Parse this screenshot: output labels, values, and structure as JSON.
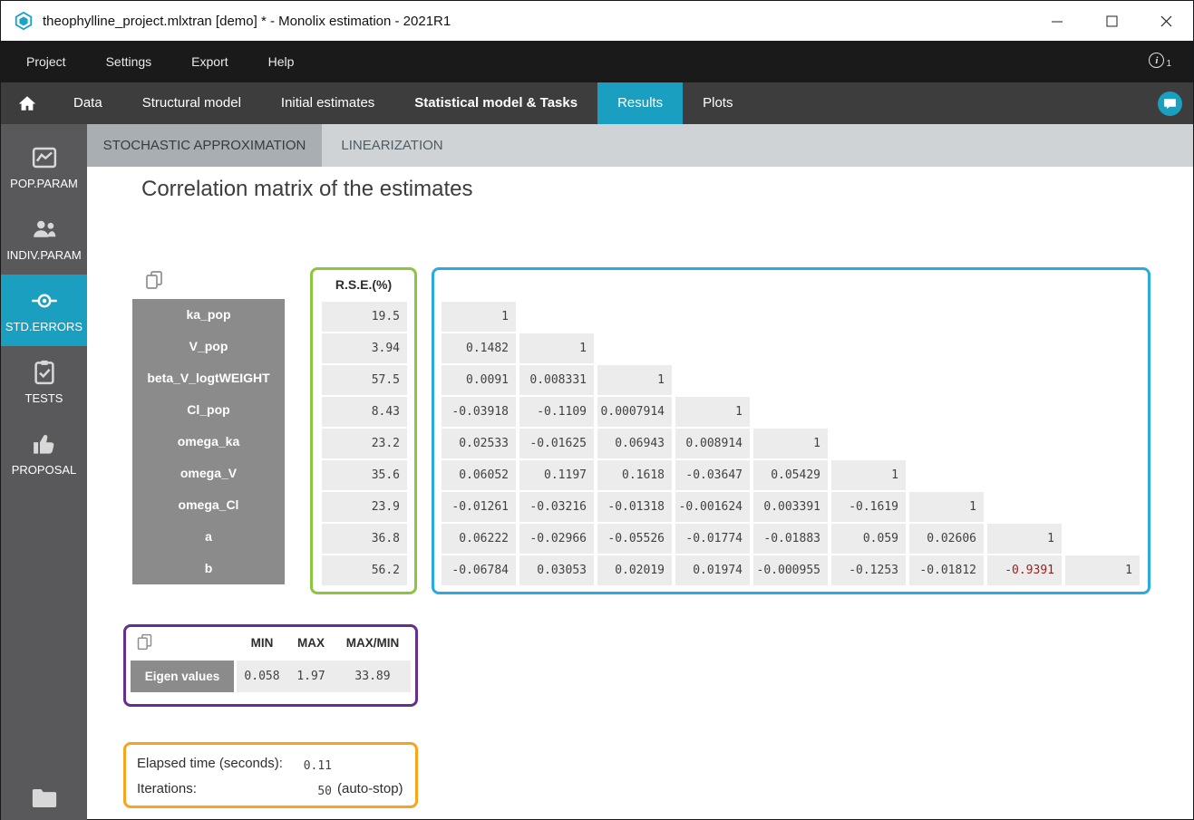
{
  "window": {
    "title": "theophylline_project.mlxtran [demo] * - Monolix estimation - 2021R1"
  },
  "menubar": {
    "items": [
      "Project",
      "Settings",
      "Export",
      "Help"
    ],
    "info_badge": "1"
  },
  "nav": {
    "tabs": [
      {
        "label": "Data",
        "active": false,
        "bold": false
      },
      {
        "label": "Structural model",
        "active": false,
        "bold": false
      },
      {
        "label": "Initial estimates",
        "active": false,
        "bold": false
      },
      {
        "label": "Statistical model & Tasks",
        "active": false,
        "bold": true
      },
      {
        "label": "Results",
        "active": true,
        "bold": false
      },
      {
        "label": "Plots",
        "active": false,
        "bold": false
      }
    ]
  },
  "subtabs": [
    {
      "label": "STOCHASTIC APPROXIMATION",
      "active": true
    },
    {
      "label": "LINEARIZATION",
      "active": false
    }
  ],
  "sidebar": {
    "items": [
      {
        "label": "POP.PARAM",
        "icon": "chart-icon",
        "active": false
      },
      {
        "label": "INDIV.PARAM",
        "icon": "people-icon",
        "active": false
      },
      {
        "label": "STD.ERRORS",
        "icon": "commit-target-icon",
        "active": true
      },
      {
        "label": "TESTS",
        "icon": "clipboard-check-icon",
        "active": false
      },
      {
        "label": "PROPOSAL",
        "icon": "thumbs-up-icon",
        "active": false
      }
    ]
  },
  "main": {
    "title": "Correlation matrix of the estimates",
    "rse_header": "R.S.E.(%)",
    "rows": [
      {
        "label": "ka_pop",
        "rse": "19.5",
        "corr": [
          "1"
        ]
      },
      {
        "label": "V_pop",
        "rse": "3.94",
        "corr": [
          "0.1482",
          "1"
        ]
      },
      {
        "label": "beta_V_logtWEIGHT",
        "rse": "57.5",
        "corr": [
          "0.0091",
          "0.008331",
          "1"
        ]
      },
      {
        "label": "Cl_pop",
        "rse": "8.43",
        "corr": [
          "-0.03918",
          "-0.1109",
          "0.0007914",
          "1"
        ]
      },
      {
        "label": "omega_ka",
        "rse": "23.2",
        "corr": [
          "0.02533",
          "-0.01625",
          "0.06943",
          "0.008914",
          "1"
        ]
      },
      {
        "label": "omega_V",
        "rse": "35.6",
        "corr": [
          "0.06052",
          "0.1197",
          "0.1618",
          "-0.03647",
          "0.05429",
          "1"
        ]
      },
      {
        "label": "omega_Cl",
        "rse": "23.9",
        "corr": [
          "-0.01261",
          "-0.03216",
          "-0.01318",
          "-0.001624",
          "0.003391",
          "-0.1619",
          "1"
        ]
      },
      {
        "label": "a",
        "rse": "36.8",
        "corr": [
          "0.06222",
          "-0.02966",
          "-0.05526",
          "-0.01774",
          "-0.01883",
          "0.059",
          "0.02606",
          "1"
        ]
      },
      {
        "label": "b",
        "rse": "56.2",
        "corr": [
          "-0.06784",
          "0.03053",
          "0.02019",
          "0.01974",
          "-0.000955",
          "-0.1253",
          "-0.01812",
          "-0.9391",
          "1"
        ],
        "highlight_index": 7
      }
    ],
    "eigen": {
      "headers": [
        "MIN",
        "MAX",
        "MAX/MIN"
      ],
      "row_label": "Eigen values",
      "values": [
        "0.058",
        "1.97",
        "33.89"
      ]
    },
    "timing": {
      "elapsed_label": "Elapsed time (seconds):",
      "elapsed_value": "0.11",
      "iterations_label": "Iterations:",
      "iterations_value": "50",
      "iterations_suffix": "(auto-stop)"
    }
  },
  "colors": {
    "accent_teal": "#1a9fc0",
    "rse_border": "#8cc63e",
    "matrix_border": "#29abe2",
    "eigen_border": "#63308e",
    "timing_border": "#f8a41c",
    "row_label_bg": "#8b8b8b",
    "cell_bg": "#ececec",
    "highlight_value": "#a11d1d"
  }
}
